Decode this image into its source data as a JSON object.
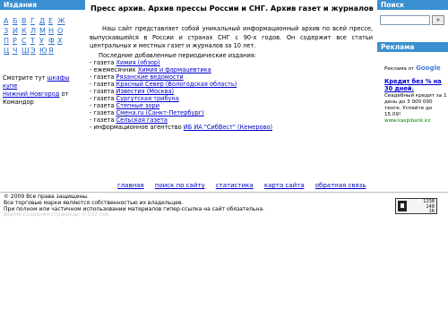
{
  "left": {
    "header": "Издания",
    "alphabet": [
      [
        "А",
        "Б",
        "В",
        "Г",
        "Д",
        "Е",
        "Ж"
      ],
      [
        "З",
        "И",
        "К",
        "Л",
        "М",
        "Н",
        "О"
      ],
      [
        "П",
        "Р",
        "С",
        "Т",
        "У",
        "Ф",
        "Х"
      ],
      [
        "Ц",
        "Ч",
        "Ш",
        "Э",
        "Ю",
        "Я"
      ]
    ],
    "note": {
      "prefix": "Смотрите тут ",
      "link1": "шкафы купе",
      "link2": "Нижний Новгород",
      "suffix": " от Командор"
    }
  },
  "main": {
    "title": "Пресс архив. Архив прессы России и СНГ. Архив газет и журналов",
    "intro": "Наш сайт представляет собой уникальный информационный архив по всей прессе, выпускавшейся в России и странах СНГ с 90-х годов. Он содержит все статьи центральных и местных газет и журналов за 10 лет.",
    "latest_heading": "Последние добавленные периодические издания:",
    "latest": [
      {
        "prefix": "- газета ",
        "link": "Химия (обзор)"
      },
      {
        "prefix": "- ежемесячник ",
        "link": "Химия и фармацевтика"
      },
      {
        "prefix": "- газета ",
        "link": "Рязанские ведомости"
      },
      {
        "prefix": "- газета ",
        "link": "Красный Север (Вологодская область)"
      },
      {
        "prefix": "- газета ",
        "link": "Известия (Москва)"
      },
      {
        "prefix": "- газета ",
        "link": "Сургутская трибуна"
      },
      {
        "prefix": "- газета ",
        "link": "Степные зори"
      },
      {
        "prefix": "- газета ",
        "link": "Смена.ru (Санкт-Петербург)"
      },
      {
        "prefix": "- газета ",
        "link": "Сельская газета"
      },
      {
        "prefix": "- информационное агентство ",
        "link": "ИБ ИА \"СибВест\" (Кемерово)"
      }
    ]
  },
  "right": {
    "search_header": "Поиск",
    "search_value": "",
    "search_button": "»",
    "ads_header": "Реклама",
    "ad_label": "Реклама от",
    "ad_brand": "Google",
    "ad_title": "Кредит без % на 30 дней.",
    "ad_text": "Свадебный кредит за 1 день до 3 000 000 тенге. Успейте до 15.09!",
    "ad_url": "www.kaspibank.kz"
  },
  "nav": [
    "главная",
    "поиск по сайту",
    "статистика",
    "карта сайта",
    "обратная связь"
  ],
  "footer": {
    "line1": "© 2009 Все права защищены.",
    "line2": "Все торговые марки являются собственностью их владельцев.",
    "line3": "При полном или частичном использовании материалов гипер-ссылка на сайт обязательна.",
    "line4": "Время создания страницы: 0.037 сек."
  },
  "counter": {
    "lines": [
      "1238",
      "148",
      "16"
    ]
  }
}
